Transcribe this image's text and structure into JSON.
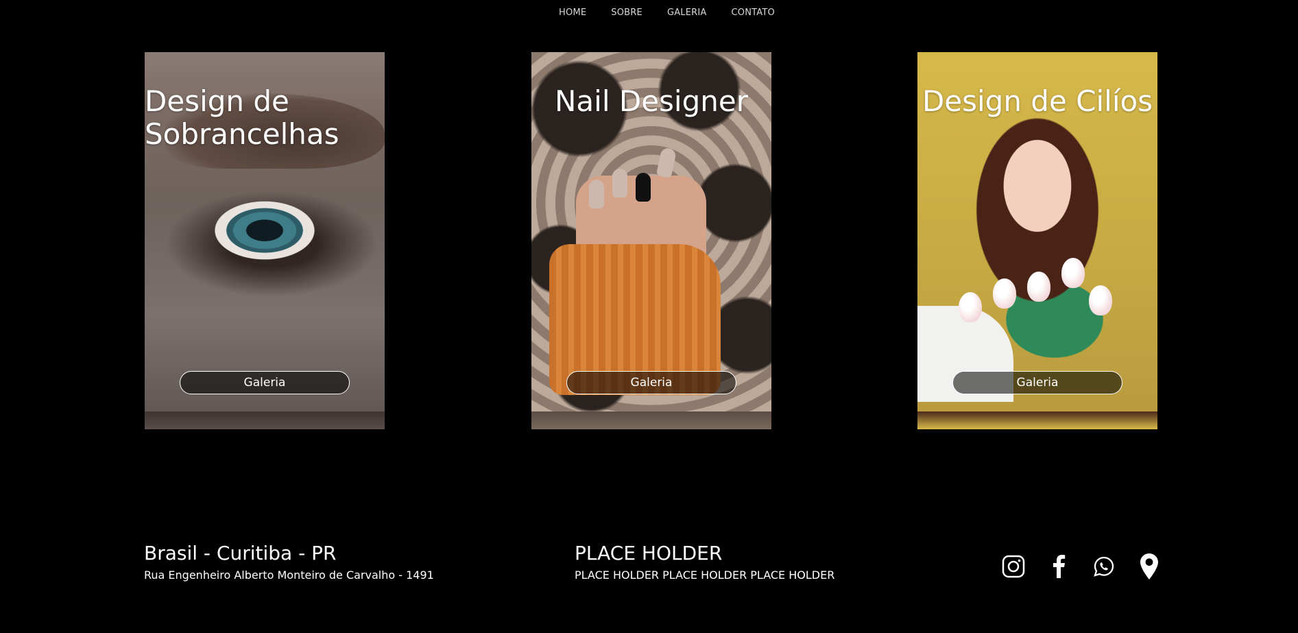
{
  "nav": {
    "items": [
      {
        "label": "HOME"
      },
      {
        "label": "SOBRE"
      },
      {
        "label": "GALERIA"
      },
      {
        "label": "CONTATO"
      }
    ]
  },
  "cards": [
    {
      "title": "Design de Sobrancelhas",
      "button_label": "Galeria",
      "image": "eye-photo"
    },
    {
      "title": "Nail Designer",
      "button_label": "Galeria",
      "image": "nails-photo"
    },
    {
      "title": "Design de Cilíos",
      "button_label": "Galeria",
      "image": "woman-with-flowers-photo"
    }
  ],
  "footer": {
    "location_title": "Brasil - Curitiba - PR",
    "address": "Rua Engenheiro Alberto Monteiro de Carvalho - 1491",
    "placeholder_title": "PLACE HOLDER",
    "placeholder_text": "PLACE HOLDER PLACE HOLDER PLACE HOLDER",
    "social_icons": [
      "instagram-icon",
      "facebook-icon",
      "whatsapp-icon",
      "location-pin-icon"
    ]
  },
  "colors": {
    "background": "#000000",
    "text": "#ffffff",
    "nav_text": "#d8d8d8"
  }
}
